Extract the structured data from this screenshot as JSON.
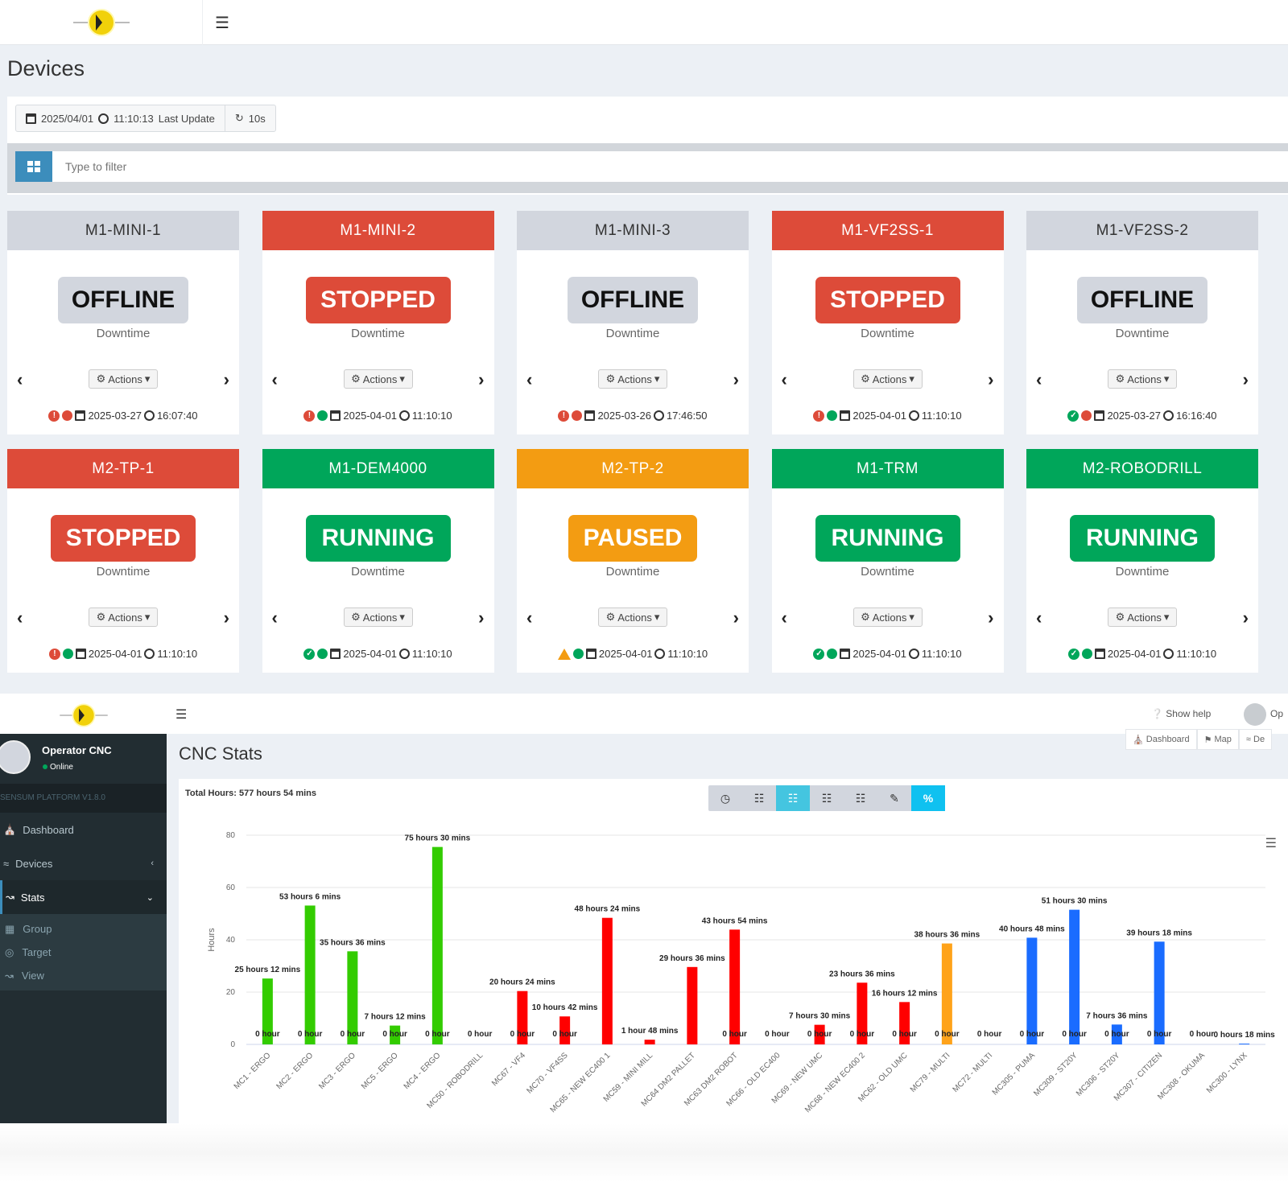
{
  "devices_app": {
    "page_title": "Devices",
    "last_update": {
      "date": "2025/04/01",
      "time": "11:10:13",
      "label": "Last Update",
      "refresh": "10s"
    },
    "filter": {
      "placeholder": "Type to filter"
    },
    "actions_label": "Actions",
    "downtime_label": "Downtime",
    "devices": [
      {
        "name": "M1-MINI-1",
        "status": "OFFLINE",
        "header_color": "grey",
        "alert": "error",
        "dot": "red",
        "date": "2025-03-27",
        "time": "16:07:40"
      },
      {
        "name": "M1-MINI-2",
        "status": "STOPPED",
        "header_color": "red",
        "alert": "error",
        "dot": "green",
        "date": "2025-04-01",
        "time": "11:10:10"
      },
      {
        "name": "M1-MINI-3",
        "status": "OFFLINE",
        "header_color": "grey",
        "alert": "error",
        "dot": "red",
        "date": "2025-03-26",
        "time": "17:46:50"
      },
      {
        "name": "M1-VF2SS-1",
        "status": "STOPPED",
        "header_color": "red",
        "alert": "error",
        "dot": "green",
        "date": "2025-04-01",
        "time": "11:10:10"
      },
      {
        "name": "M1-VF2SS-2",
        "status": "OFFLINE",
        "header_color": "grey",
        "alert": "ok",
        "dot": "red",
        "date": "2025-03-27",
        "time": "16:16:40"
      },
      {
        "name": "M2-TP-1",
        "status": "STOPPED",
        "header_color": "red",
        "alert": "error",
        "dot": "green",
        "date": "2025-04-01",
        "time": "11:10:10"
      },
      {
        "name": "M1-DEM4000",
        "status": "RUNNING",
        "header_color": "green",
        "alert": "ok",
        "dot": "green",
        "date": "2025-04-01",
        "time": "11:10:10"
      },
      {
        "name": "M2-TP-2",
        "status": "PAUSED",
        "header_color": "orange",
        "alert": "warning",
        "dot": "green",
        "date": "2025-04-01",
        "time": "11:10:10"
      },
      {
        "name": "M1-TRM",
        "status": "RUNNING",
        "header_color": "green",
        "alert": "ok",
        "dot": "green",
        "date": "2025-04-01",
        "time": "11:10:10"
      },
      {
        "name": "M2-ROBODRILL",
        "status": "RUNNING",
        "header_color": "green",
        "alert": "ok",
        "dot": "green",
        "date": "2025-04-01",
        "time": "11:10:10"
      }
    ]
  },
  "stats_app": {
    "header": {
      "help": "Show help",
      "user": "Op"
    },
    "sidebar": {
      "user_name": "Operator CNC",
      "user_status": "Online",
      "version": "SENSUM PLATFORM V1.8.0",
      "items": [
        {
          "label": "Dashboard"
        },
        {
          "label": "Devices"
        },
        {
          "label": "Stats"
        }
      ],
      "stats_sub": [
        {
          "label": "Group"
        },
        {
          "label": "Target"
        },
        {
          "label": "View"
        }
      ]
    },
    "page_title": "CNC Stats",
    "breadcrumbs": [
      "Dashboard",
      "Map",
      "De"
    ],
    "total_hours": "Total Hours: 577 hours 54 mins",
    "colors": {
      "green": "#33cc00",
      "red": "#ff0000",
      "orange": "#ffa31a",
      "blue": "#1a6cff"
    }
  },
  "chart_data": {
    "type": "bar",
    "ylabel": "Hours",
    "ylim": [
      0,
      80
    ],
    "yticks": [
      0,
      20,
      40,
      60,
      80
    ],
    "categories": [
      "MC1 - ERGO",
      "MC2 - ERGO",
      "MC3 - ERGO",
      "MC5 - ERGO",
      "MC4 - ERGO",
      "MC50 - ROBODRILL",
      "MC67 - VF4",
      "MC70 - VF4SS",
      "MC65 - NEW EC400 1",
      "MC59 - MINI MILL",
      "MC64 DM2 PALLET",
      "MC63 DM2 ROBOT",
      "MC66 - OLD EC400",
      "MC69 - NEW UMC",
      "MC68 - NEW EC400 2",
      "MC62 - OLD UMC",
      "MC79 - MULTI",
      "MC72 - MULTI",
      "MC305 - PUMA",
      "MC309 - ST20Y",
      "MC306 - ST20Y",
      "MC307 - CITIZEN",
      "MC308 - OKUMA",
      "MC300 - LYNX"
    ],
    "values": [
      25.2,
      53.1,
      35.6,
      7.2,
      75.5,
      0,
      20.4,
      10.7,
      48.4,
      1.8,
      29.6,
      43.9,
      0,
      7.5,
      23.6,
      16.2,
      38.6,
      0,
      40.8,
      51.5,
      7.6,
      39.3,
      0,
      0.3
    ],
    "bar_colors": [
      "green",
      "green",
      "green",
      "green",
      "green",
      "green",
      "red",
      "red",
      "red",
      "red",
      "red",
      "red",
      "red",
      "red",
      "red",
      "red",
      "orange",
      "orange",
      "blue",
      "blue",
      "blue",
      "blue",
      "blue",
      "blue"
    ],
    "value_labels": [
      "25 hours 12 mins",
      "53 hours 6 mins",
      "35 hours 36 mins",
      "7 hours 12 mins",
      "75 hours 30 mins",
      "0 hour",
      "20 hours 24 mins",
      "10 hours 42 mins",
      "48 hours 24 mins",
      "1 hour 48 mins",
      "29 hours 36 mins",
      "43 hours 54 mins",
      "0 hour",
      "7 hours 30 mins",
      "23 hours 36 mins",
      "16 hours 12 mins",
      "38 hours 36 mins",
      "0 hour",
      "40 hours 48 mins",
      "51 hours 30 mins",
      "7 hours 36 mins",
      "39 hours 18 mins",
      "0 hour",
      "0 hours 18 mins"
    ],
    "base_labels": [
      "0 hour",
      "0 hour",
      "0 hour",
      "0 hour",
      "0 hour",
      "",
      "0 hour",
      "0 hour",
      "",
      "",
      "",
      "0 hour",
      "",
      "0 hour",
      "0 hour",
      "0 hour",
      "0 hour",
      "",
      "0 hour",
      "0 hour",
      "0 hour",
      "0 hour",
      "",
      ""
    ]
  }
}
